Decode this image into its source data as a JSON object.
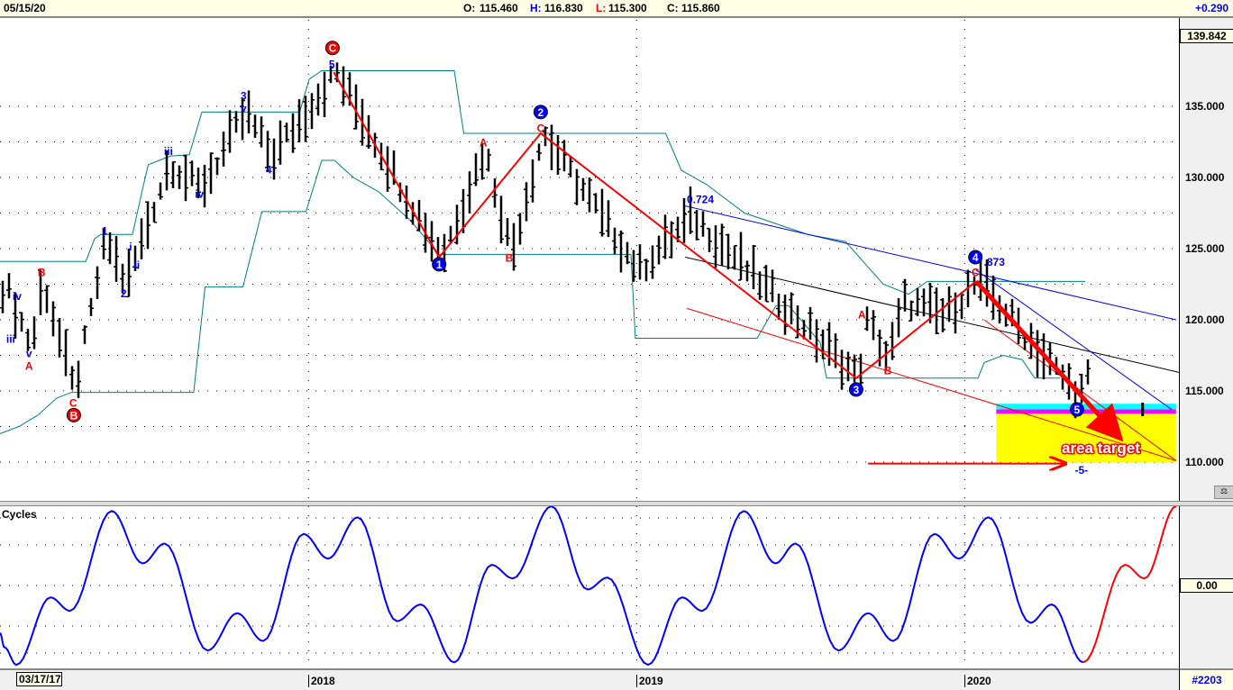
{
  "header": {
    "date": "05/15/20",
    "open_label": "O:",
    "open": "115.460",
    "high_label": "H:",
    "high": "116.830",
    "low_label": "L:",
    "low": "115.300",
    "close_label": "C:",
    "close": "115.860",
    "change": "+0.290"
  },
  "price_axis": {
    "current": "139.842",
    "ticks": [
      "135.000",
      "130.000",
      "125.000",
      "120.000",
      "115.000",
      "110.000"
    ]
  },
  "cycles_panel": {
    "title": "Cycles",
    "zero_label": "0.00"
  },
  "time_axis": {
    "start": "03/17/17",
    "labels": [
      "2018",
      "2019",
      "2020"
    ]
  },
  "footer": {
    "chart_id": "#2203"
  },
  "colors": {
    "up_text": "#0000ff",
    "low_text": "#ff0000",
    "bars": "#000000",
    "envelope": "#008080",
    "cycle": "#0000ff",
    "projection": "#ff0000",
    "target": "#ffff00",
    "cyan": "#00ffff",
    "magenta": "#ff00ff"
  },
  "chart_data": {
    "type": "ohlc-bar",
    "ylim": [
      107.5,
      139.842
    ],
    "yticks": [
      135,
      130,
      125,
      120,
      115,
      110
    ],
    "bars_count": 173,
    "year_bars": [
      48.9,
      100.9,
      152.9
    ],
    "price_pivots": [
      [
        0,
        122.2
      ],
      [
        0.7,
        122.2
      ],
      [
        4.6,
        118.1
      ],
      [
        6.4,
        122.8
      ],
      [
        11.4,
        114.9
      ],
      [
        16.4,
        125.7
      ],
      [
        19.6,
        122.5
      ],
      [
        26.4,
        131
      ],
      [
        31.4,
        129.2
      ],
      [
        38.6,
        134.6
      ],
      [
        42.6,
        131.4
      ],
      [
        52.9,
        137.4
      ],
      [
        69.6,
        124.4
      ],
      [
        76.4,
        132
      ],
      [
        80.7,
        124.7
      ],
      [
        85.7,
        133.1
      ],
      [
        100.9,
        123.5
      ],
      [
        109.3,
        127.3
      ],
      [
        135.7,
        115.9
      ],
      [
        137.1,
        120
      ],
      [
        140.4,
        117.2
      ],
      [
        142.9,
        121.3
      ],
      [
        149.3,
        120.3
      ],
      [
        154.7,
        122.7
      ],
      [
        170.7,
        114.6
      ],
      [
        172,
        115.9
      ]
    ],
    "envelope_upper": [
      [
        0,
        124.1
      ],
      [
        13.6,
        124.1
      ],
      [
        15,
        125.7
      ],
      [
        16,
        126
      ],
      [
        21,
        126
      ],
      [
        22.5,
        129
      ],
      [
        23.5,
        130.9
      ],
      [
        27,
        131.5
      ],
      [
        30,
        131.6
      ],
      [
        32,
        134.6
      ],
      [
        47.5,
        134.6
      ],
      [
        49,
        136.9
      ],
      [
        51,
        137.5
      ],
      [
        72,
        137.5
      ],
      [
        73.5,
        133.1
      ],
      [
        105.5,
        133.1
      ],
      [
        108,
        130.5
      ],
      [
        112,
        129.5
      ],
      [
        118,
        127.5
      ],
      [
        128,
        126
      ],
      [
        134,
        125.5
      ],
      [
        137,
        124
      ],
      [
        140,
        122.5
      ],
      [
        144,
        121.8
      ],
      [
        147,
        122.7
      ],
      [
        172,
        122.7
      ]
    ],
    "envelope_lower": [
      [
        0,
        112
      ],
      [
        3,
        112.5
      ],
      [
        6,
        113.3
      ],
      [
        9,
        114.5
      ],
      [
        11.3,
        114.9
      ],
      [
        30.7,
        114.9
      ],
      [
        32.5,
        122.3
      ],
      [
        38.5,
        122.3
      ],
      [
        41.5,
        127.6
      ],
      [
        48.5,
        127.6
      ],
      [
        51,
        131.2
      ],
      [
        53,
        131.2
      ],
      [
        56,
        130
      ],
      [
        60,
        129
      ],
      [
        65,
        127
      ],
      [
        69.6,
        124.6
      ],
      [
        100,
        124.6
      ],
      [
        100.7,
        118.7
      ],
      [
        120,
        118.7
      ],
      [
        123,
        121
      ],
      [
        125,
        121
      ],
      [
        130,
        118.4
      ],
      [
        131,
        115.9
      ],
      [
        155,
        115.9
      ],
      [
        156,
        117
      ],
      [
        159,
        117.5
      ],
      [
        162,
        117.2
      ],
      [
        164,
        115.9
      ],
      [
        168,
        115.9
      ]
    ],
    "trendlines": [
      {
        "name": "blue-channel-upper",
        "color": "#0000ff",
        "from": [
          108.6,
          128.0
        ],
        "to": [
          186.4,
          120.0
        ]
      },
      {
        "name": "black-trendline",
        "color": "#000000",
        "from": [
          108.6,
          124.4
        ],
        "to": [
          186.9,
          116.3
        ]
      },
      {
        "name": "red-channel-lower",
        "color": "#ff0000",
        "from": [
          108.9,
          120.8
        ],
        "to": [
          186.4,
          110.1
        ]
      },
      {
        "name": "blue-fan-line",
        "color": "#0000ff",
        "from": [
          154.7,
          123.5
        ],
        "to": [
          185.7,
          113.7
        ]
      },
      {
        "name": "red-fan-line",
        "color": "#ff0000",
        "from": [
          156,
          120
        ],
        "to": [
          186.4,
          110.1
        ]
      }
    ],
    "wave_zigzag": [
      [
        52.9,
        137.4
      ],
      [
        69.6,
        124.4
      ],
      [
        85.7,
        133.1
      ],
      [
        135.7,
        115.9
      ],
      [
        154.7,
        122.7
      ]
    ],
    "projection_arrow": {
      "from": [
        154.7,
        122.7
      ],
      "to": [
        177.1,
        111.9
      ]
    },
    "horizontal_arrow": {
      "from": [
        137.6,
        109.9
      ],
      "to": [
        168.6,
        109.9
      ]
    },
    "target_zone": {
      "from_bar": 157.9,
      "to_bar": 186.4,
      "cyan": [
        114.1,
        113.7
      ],
      "magenta": [
        113.7,
        113.4
      ],
      "yellow": [
        113.4,
        110.0
      ]
    },
    "target_label": "area target",
    "wave_labels": [
      {
        "t": "iii",
        "c": "blue",
        "b": 1.7,
        "p": 118.7
      },
      {
        "t": "iv",
        "c": "blue",
        "b": 2.7,
        "p": 121.7
      },
      {
        "t": "v",
        "c": "blue",
        "b": 4.6,
        "p": 117.7
      },
      {
        "t": "A",
        "c": "red",
        "b": 4.6,
        "p": 116.8
      },
      {
        "t": "B",
        "c": "red",
        "b": 6.6,
        "p": 123.4
      },
      {
        "t": "C",
        "c": "red",
        "b": 11.6,
        "p": 114.2
      },
      {
        "t": "B",
        "c": "red",
        "b": 11.7,
        "p": 113.3,
        "circle": true
      },
      {
        "t": "1",
        "c": "blue",
        "b": 16.6,
        "p": 126.3
      },
      {
        "t": "2",
        "c": "blue",
        "b": 19.6,
        "p": 121.9
      },
      {
        "t": "i",
        "c": "blue",
        "b": 20.7,
        "p": 125.2
      },
      {
        "t": "ii",
        "c": "blue",
        "b": 21.7,
        "p": 123.9
      },
      {
        "t": "iii",
        "c": "blue",
        "b": 26.7,
        "p": 131.9
      },
      {
        "t": "iv",
        "c": "blue",
        "b": 31.6,
        "p": 128.9
      },
      {
        "t": "3",
        "c": "blue",
        "b": 38.6,
        "p": 135.8
      },
      {
        "t": "v",
        "c": "blue",
        "b": 38.6,
        "p": 134.9
      },
      {
        "t": "4",
        "c": "blue",
        "b": 42.6,
        "p": 130.6
      },
      {
        "t": "C",
        "c": "red",
        "b": 52.7,
        "p": 139.1,
        "circle": true
      },
      {
        "t": "5",
        "c": "blue",
        "b": 52.6,
        "p": 138.0
      },
      {
        "t": "1",
        "c": "blue",
        "b": 69.6,
        "p": 123.9,
        "circle": true
      },
      {
        "t": "A",
        "c": "red",
        "b": 76.6,
        "p": 132.5
      },
      {
        "t": "B",
        "c": "red",
        "b": 80.7,
        "p": 124.4
      },
      {
        "t": "2",
        "c": "blue",
        "b": 85.7,
        "p": 134.6,
        "circle": true
      },
      {
        "t": "C",
        "c": "red",
        "b": 85.7,
        "p": 133.5
      },
      {
        "t": "0.724",
        "c": "blue",
        "b": 111,
        "p": 128.5
      },
      {
        "t": "3",
        "c": "blue",
        "b": 135.7,
        "p": 115.1,
        "circle": true
      },
      {
        "t": "A",
        "c": "red",
        "b": 136.6,
        "p": 120.4
      },
      {
        "t": "B",
        "c": "red",
        "b": 140.7,
        "p": 116.5
      },
      {
        "t": "4",
        "c": "blue",
        "b": 154.6,
        "p": 124.4,
        "circle": true
      },
      {
        "t": ".873",
        "c": "blue",
        "b": 157.6,
        "p": 124.1
      },
      {
        "t": "C",
        "c": "red",
        "b": 154.6,
        "p": 123.4
      },
      {
        "t": "5",
        "c": "blue",
        "b": 170.7,
        "p": 113.7,
        "circle": true
      },
      {
        "t": "-5-",
        "c": "blue",
        "b": 171.4,
        "p": 109.5
      }
    ],
    "cycle": {
      "ylim": [
        -1.05,
        1.05
      ],
      "history": [
        [
          0,
          -0.6
        ],
        [
          0.7,
          -0.78
        ],
        [
          2.6,
          -1.0
        ],
        [
          8,
          -0.15
        ],
        [
          11.1,
          -0.32
        ],
        [
          17.7,
          0.94
        ],
        [
          22.6,
          0.28
        ],
        [
          26.1,
          0.53
        ],
        [
          32.9,
          -0.82
        ],
        [
          37.6,
          -0.35
        ],
        [
          41.7,
          -0.7
        ],
        [
          48.1,
          0.65
        ],
        [
          52,
          0.34
        ],
        [
          56.7,
          0.86
        ],
        [
          62.9,
          -0.45
        ],
        [
          66.7,
          -0.24
        ],
        [
          72,
          -0.97
        ],
        [
          77.9,
          0.26
        ],
        [
          81.3,
          0.09
        ],
        [
          87.4,
          1.0
        ],
        [
          93.1,
          -0.05
        ],
        [
          96.3,
          0.1
        ],
        [
          102.7,
          -1.0
        ],
        [
          108.1,
          -0.15
        ],
        [
          111.3,
          -0.32
        ],
        [
          117.9,
          0.94
        ],
        [
          122.9,
          0.28
        ],
        [
          126.1,
          0.53
        ],
        [
          132.9,
          -0.82
        ],
        [
          137.6,
          -0.35
        ],
        [
          141.6,
          -0.7
        ],
        [
          148.1,
          0.65
        ],
        [
          152,
          0.34
        ],
        [
          156.7,
          0.86
        ],
        [
          163.3,
          -0.47
        ],
        [
          166.7,
          -0.24
        ],
        [
          171.7,
          -0.97
        ]
      ],
      "projection": [
        [
          171.7,
          -0.97
        ],
        [
          178.3,
          0.26
        ],
        [
          181.4,
          0.09
        ],
        [
          186.4,
          1.0
        ]
      ]
    }
  }
}
